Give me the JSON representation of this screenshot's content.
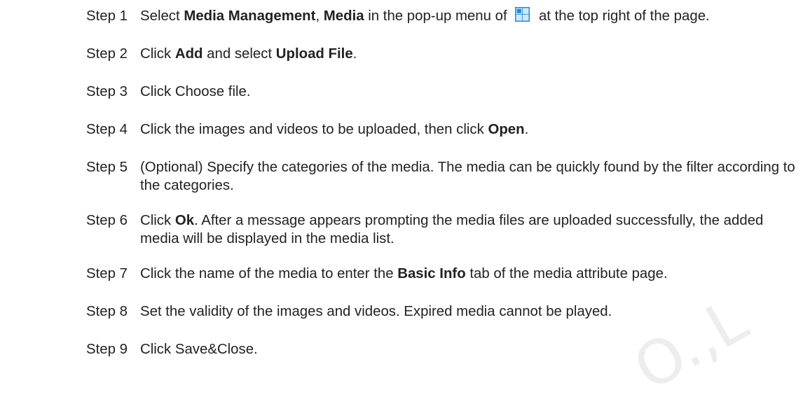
{
  "steps": [
    {
      "label": "Step 1",
      "segments": [
        {
          "text": "Select "
        },
        {
          "text": "Media Management",
          "bold": true
        },
        {
          "text": ", "
        },
        {
          "text": "Media",
          "bold": true
        },
        {
          "text": " in the pop-up menu of "
        },
        {
          "icon": "menu-grid-icon"
        },
        {
          "text": " at the top right of the page."
        }
      ]
    },
    {
      "label": "Step 2",
      "segments": [
        {
          "text": "Click "
        },
        {
          "text": "Add",
          "bold": true
        },
        {
          "text": " and select "
        },
        {
          "text": "Upload File",
          "bold": true
        },
        {
          "text": "."
        }
      ]
    },
    {
      "label": "Step 3",
      "segments": [
        {
          "text": "Click Choose file."
        }
      ]
    },
    {
      "label": "Step 4",
      "segments": [
        {
          "text": "Click the images and videos to be uploaded, then click "
        },
        {
          "text": "Open",
          "bold": true
        },
        {
          "text": "."
        }
      ]
    },
    {
      "label": "Step 5",
      "segments": [
        {
          "text": "(Optional) Specify the categories of the media. The media can be quickly found by the filter according to the categories."
        }
      ]
    },
    {
      "label": "Step 6",
      "segments": [
        {
          "text": "Click "
        },
        {
          "text": "Ok",
          "bold": true
        },
        {
          "text": ". After a message appears prompting the media files are uploaded successfully, the added media will be displayed in the media list."
        }
      ]
    },
    {
      "label": "Step 7",
      "segments": [
        {
          "text": "Click the name of the media to enter the "
        },
        {
          "text": "Basic Info",
          "bold": true
        },
        {
          "text": " tab of the media attribute page."
        }
      ]
    },
    {
      "label": "Step 8",
      "segments": [
        {
          "text": "Set the validity of the images and videos. Expired media cannot be played."
        }
      ]
    },
    {
      "label": "Step 9",
      "segments": [
        {
          "text": "Click Save&Close."
        }
      ]
    }
  ],
  "colors": {
    "text": "#222222",
    "icon_blue": "#1E88E5",
    "icon_light": "#CFE8FF",
    "watermark": "#EDEDED"
  }
}
